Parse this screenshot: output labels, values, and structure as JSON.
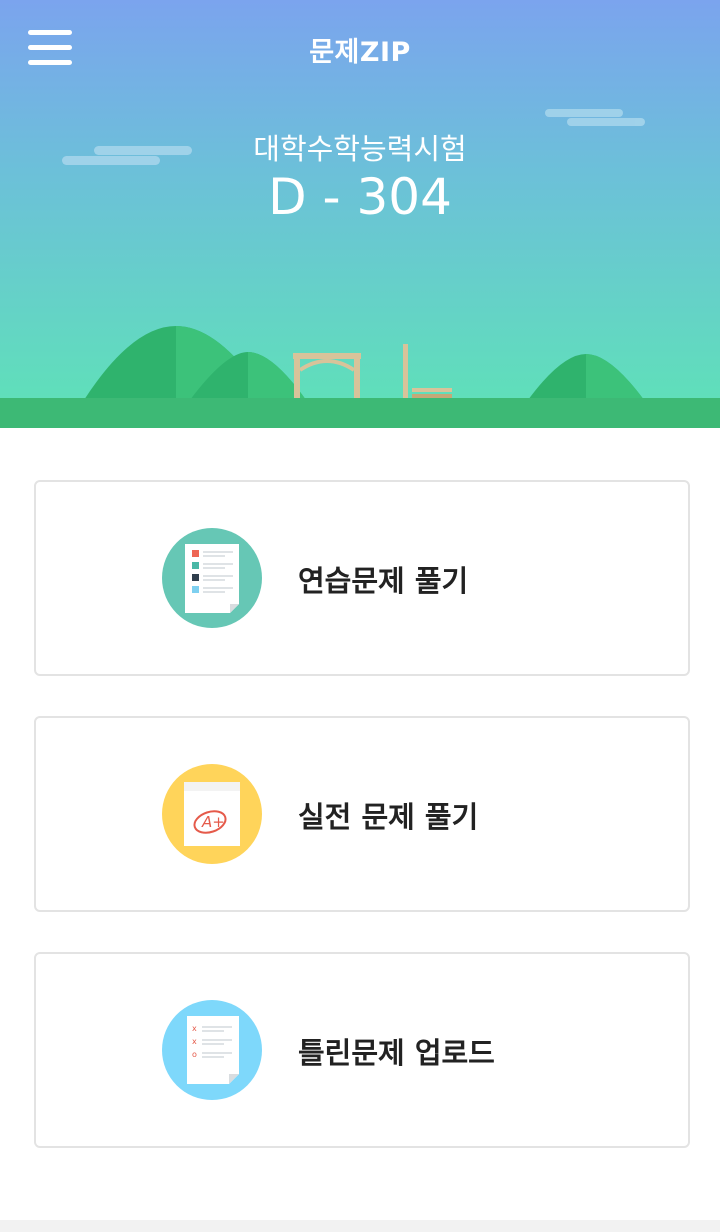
{
  "header": {
    "title": "문제ZIP",
    "menu_icon": "hamburger-menu-icon"
  },
  "hero": {
    "exam_name": "대학수학능력시험",
    "dday": "D - 304"
  },
  "menu_cards": [
    {
      "label": "연습문제 풀기",
      "icon": "practice-sheet-icon",
      "color": "#66c7b5"
    },
    {
      "label": "실전 문제 풀기",
      "icon": "graded-exam-icon",
      "color": "#ffd45a"
    },
    {
      "label": "틀린문제 업로드",
      "icon": "wrong-answer-sheet-icon",
      "color": "#7ed8fb"
    }
  ],
  "colors": {
    "sky_top": "#7ba4ee",
    "sky_bottom": "#5ee3b6",
    "ground": "#3db975"
  }
}
